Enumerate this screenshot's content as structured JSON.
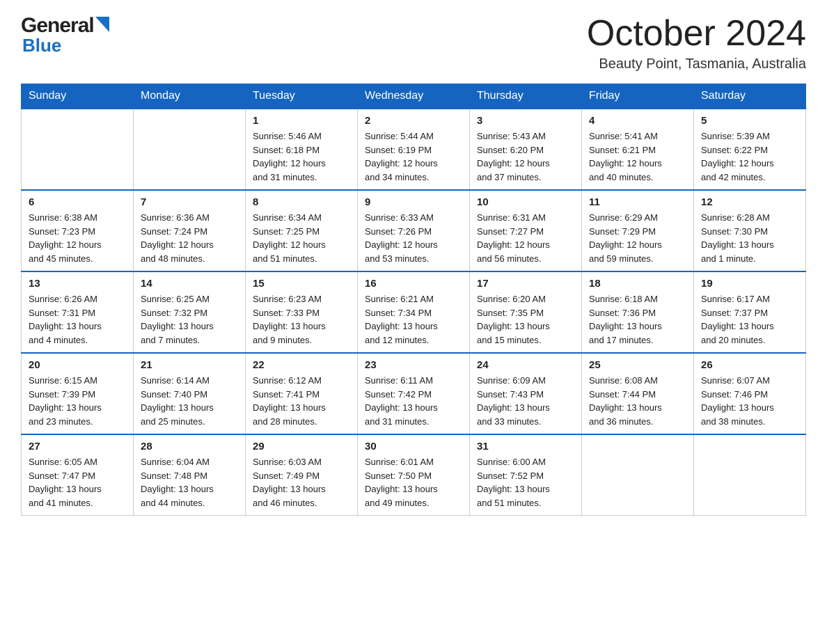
{
  "header": {
    "month_title": "October 2024",
    "location": "Beauty Point, Tasmania, Australia",
    "logo_general": "General",
    "logo_blue": "Blue"
  },
  "weekdays": [
    "Sunday",
    "Monday",
    "Tuesday",
    "Wednesday",
    "Thursday",
    "Friday",
    "Saturday"
  ],
  "weeks": [
    [
      {
        "day": "",
        "info": ""
      },
      {
        "day": "",
        "info": ""
      },
      {
        "day": "1",
        "info": "Sunrise: 5:46 AM\nSunset: 6:18 PM\nDaylight: 12 hours\nand 31 minutes."
      },
      {
        "day": "2",
        "info": "Sunrise: 5:44 AM\nSunset: 6:19 PM\nDaylight: 12 hours\nand 34 minutes."
      },
      {
        "day": "3",
        "info": "Sunrise: 5:43 AM\nSunset: 6:20 PM\nDaylight: 12 hours\nand 37 minutes."
      },
      {
        "day": "4",
        "info": "Sunrise: 5:41 AM\nSunset: 6:21 PM\nDaylight: 12 hours\nand 40 minutes."
      },
      {
        "day": "5",
        "info": "Sunrise: 5:39 AM\nSunset: 6:22 PM\nDaylight: 12 hours\nand 42 minutes."
      }
    ],
    [
      {
        "day": "6",
        "info": "Sunrise: 6:38 AM\nSunset: 7:23 PM\nDaylight: 12 hours\nand 45 minutes."
      },
      {
        "day": "7",
        "info": "Sunrise: 6:36 AM\nSunset: 7:24 PM\nDaylight: 12 hours\nand 48 minutes."
      },
      {
        "day": "8",
        "info": "Sunrise: 6:34 AM\nSunset: 7:25 PM\nDaylight: 12 hours\nand 51 minutes."
      },
      {
        "day": "9",
        "info": "Sunrise: 6:33 AM\nSunset: 7:26 PM\nDaylight: 12 hours\nand 53 minutes."
      },
      {
        "day": "10",
        "info": "Sunrise: 6:31 AM\nSunset: 7:27 PM\nDaylight: 12 hours\nand 56 minutes."
      },
      {
        "day": "11",
        "info": "Sunrise: 6:29 AM\nSunset: 7:29 PM\nDaylight: 12 hours\nand 59 minutes."
      },
      {
        "day": "12",
        "info": "Sunrise: 6:28 AM\nSunset: 7:30 PM\nDaylight: 13 hours\nand 1 minute."
      }
    ],
    [
      {
        "day": "13",
        "info": "Sunrise: 6:26 AM\nSunset: 7:31 PM\nDaylight: 13 hours\nand 4 minutes."
      },
      {
        "day": "14",
        "info": "Sunrise: 6:25 AM\nSunset: 7:32 PM\nDaylight: 13 hours\nand 7 minutes."
      },
      {
        "day": "15",
        "info": "Sunrise: 6:23 AM\nSunset: 7:33 PM\nDaylight: 13 hours\nand 9 minutes."
      },
      {
        "day": "16",
        "info": "Sunrise: 6:21 AM\nSunset: 7:34 PM\nDaylight: 13 hours\nand 12 minutes."
      },
      {
        "day": "17",
        "info": "Sunrise: 6:20 AM\nSunset: 7:35 PM\nDaylight: 13 hours\nand 15 minutes."
      },
      {
        "day": "18",
        "info": "Sunrise: 6:18 AM\nSunset: 7:36 PM\nDaylight: 13 hours\nand 17 minutes."
      },
      {
        "day": "19",
        "info": "Sunrise: 6:17 AM\nSunset: 7:37 PM\nDaylight: 13 hours\nand 20 minutes."
      }
    ],
    [
      {
        "day": "20",
        "info": "Sunrise: 6:15 AM\nSunset: 7:39 PM\nDaylight: 13 hours\nand 23 minutes."
      },
      {
        "day": "21",
        "info": "Sunrise: 6:14 AM\nSunset: 7:40 PM\nDaylight: 13 hours\nand 25 minutes."
      },
      {
        "day": "22",
        "info": "Sunrise: 6:12 AM\nSunset: 7:41 PM\nDaylight: 13 hours\nand 28 minutes."
      },
      {
        "day": "23",
        "info": "Sunrise: 6:11 AM\nSunset: 7:42 PM\nDaylight: 13 hours\nand 31 minutes."
      },
      {
        "day": "24",
        "info": "Sunrise: 6:09 AM\nSunset: 7:43 PM\nDaylight: 13 hours\nand 33 minutes."
      },
      {
        "day": "25",
        "info": "Sunrise: 6:08 AM\nSunset: 7:44 PM\nDaylight: 13 hours\nand 36 minutes."
      },
      {
        "day": "26",
        "info": "Sunrise: 6:07 AM\nSunset: 7:46 PM\nDaylight: 13 hours\nand 38 minutes."
      }
    ],
    [
      {
        "day": "27",
        "info": "Sunrise: 6:05 AM\nSunset: 7:47 PM\nDaylight: 13 hours\nand 41 minutes."
      },
      {
        "day": "28",
        "info": "Sunrise: 6:04 AM\nSunset: 7:48 PM\nDaylight: 13 hours\nand 44 minutes."
      },
      {
        "day": "29",
        "info": "Sunrise: 6:03 AM\nSunset: 7:49 PM\nDaylight: 13 hours\nand 46 minutes."
      },
      {
        "day": "30",
        "info": "Sunrise: 6:01 AM\nSunset: 7:50 PM\nDaylight: 13 hours\nand 49 minutes."
      },
      {
        "day": "31",
        "info": "Sunrise: 6:00 AM\nSunset: 7:52 PM\nDaylight: 13 hours\nand 51 minutes."
      },
      {
        "day": "",
        "info": ""
      },
      {
        "day": "",
        "info": ""
      }
    ]
  ]
}
